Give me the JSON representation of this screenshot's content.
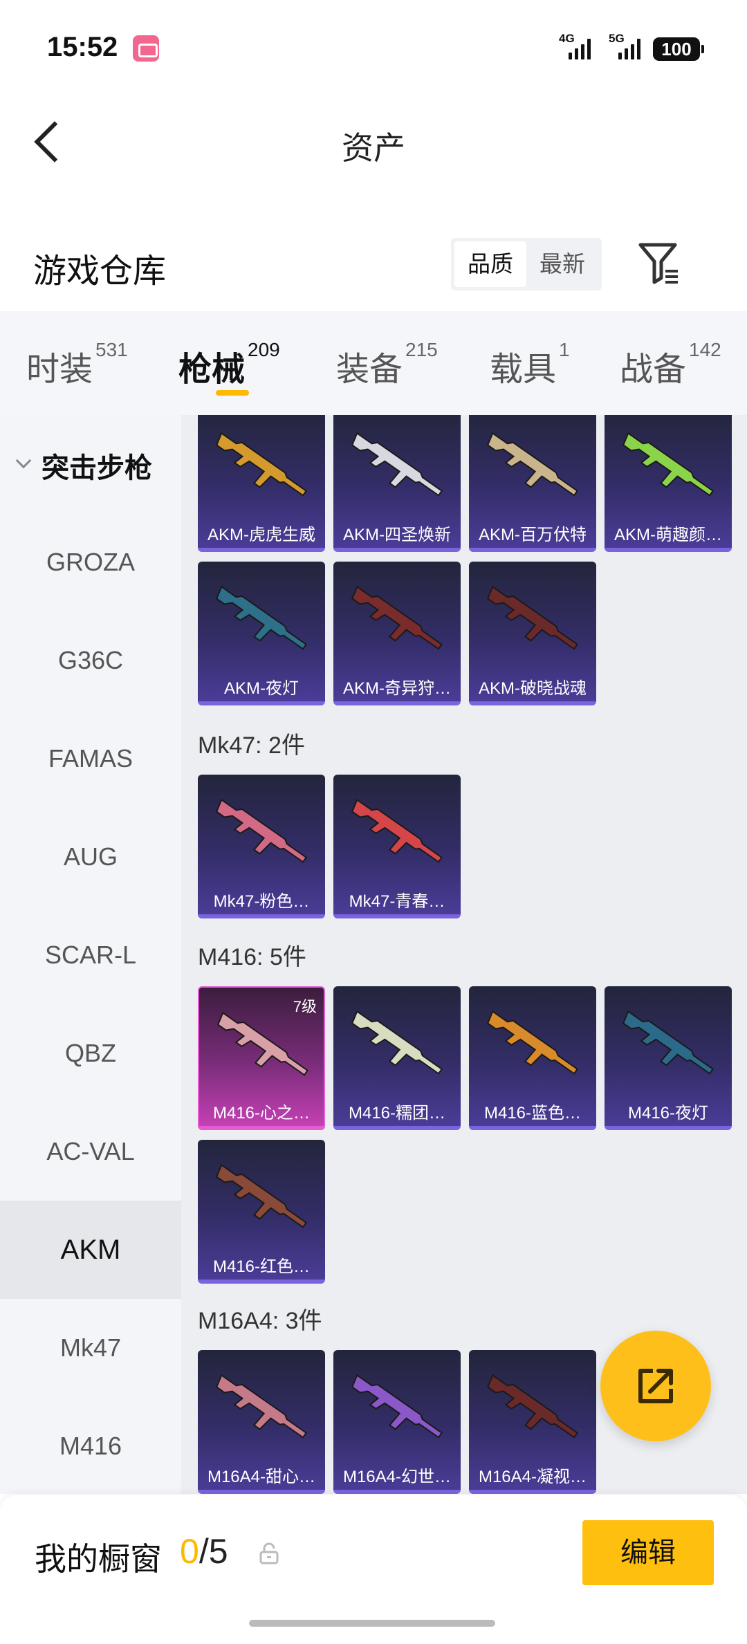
{
  "status": {
    "time": "15:52",
    "net1": "4G",
    "net2": "5G",
    "battery": "100"
  },
  "header": {
    "title": "资产"
  },
  "warehouse": {
    "title": "游戏仓库",
    "sort_options": [
      "品质",
      "最新"
    ],
    "active_sort": "品质"
  },
  "tabs": [
    {
      "label": "时装",
      "count": "531"
    },
    {
      "label": "枪械",
      "count": "209",
      "active": true
    },
    {
      "label": "装备",
      "count": "215"
    },
    {
      "label": "载具",
      "count": "1"
    },
    {
      "label": "战备",
      "count": "142"
    }
  ],
  "sidebar": {
    "group": "突击步枪",
    "items": [
      "GROZA",
      "G36C",
      "FAMAS",
      "AUG",
      "SCAR-L",
      "QBZ",
      "AC-VAL",
      "AKM",
      "Mk47",
      "M416"
    ],
    "active": "AKM"
  },
  "sections": [
    {
      "title": "",
      "items": [
        {
          "label": "AKM-虎虎生威",
          "color": "#d49a2e"
        },
        {
          "label": "AKM-四圣焕新",
          "color": "#d8d8e0"
        },
        {
          "label": "AKM-百万伏特",
          "color": "#c9b48c"
        },
        {
          "label": "AKM-萌趣颜…",
          "color": "#8bd34a"
        },
        {
          "label": "AKM-夜灯",
          "color": "#2e6f8a"
        },
        {
          "label": "AKM-奇异狩…",
          "color": "#7a2b2b"
        },
        {
          "label": "AKM-破晓战魂",
          "color": "#6b2a2a"
        }
      ]
    },
    {
      "title": "Mk47: 2件",
      "items": [
        {
          "label": "Mk47-粉色…",
          "color": "#d26a86"
        },
        {
          "label": "Mk47-青春…",
          "color": "#d4464a"
        }
      ]
    },
    {
      "title": "M416: 5件",
      "items": [
        {
          "label": "M416-心之…",
          "color": "#d9a0a8",
          "level": "7级",
          "highlight": true
        },
        {
          "label": "M416-糯团…",
          "color": "#d8dcc0"
        },
        {
          "label": "M416-蓝色…",
          "color": "#d98a2a"
        },
        {
          "label": "M416-夜灯",
          "color": "#2c6a8a"
        },
        {
          "label": "M416-红色…",
          "color": "#8a4a3a"
        }
      ]
    },
    {
      "title": "M16A4: 3件",
      "items": [
        {
          "label": "M16A4-甜心…",
          "color": "#c57a8a"
        },
        {
          "label": "M16A4-幻世…",
          "color": "#8a58c8"
        },
        {
          "label": "M16A4-凝视…",
          "color": "#6a2a2a"
        }
      ]
    }
  ],
  "bottom": {
    "showcase_label": "我的橱窗",
    "current": "0",
    "total": "/5",
    "edit_label": "编辑"
  },
  "colors": {
    "accent": "#ffb800",
    "card_bg": "#332d67",
    "card_highlight": "#c440b4"
  }
}
